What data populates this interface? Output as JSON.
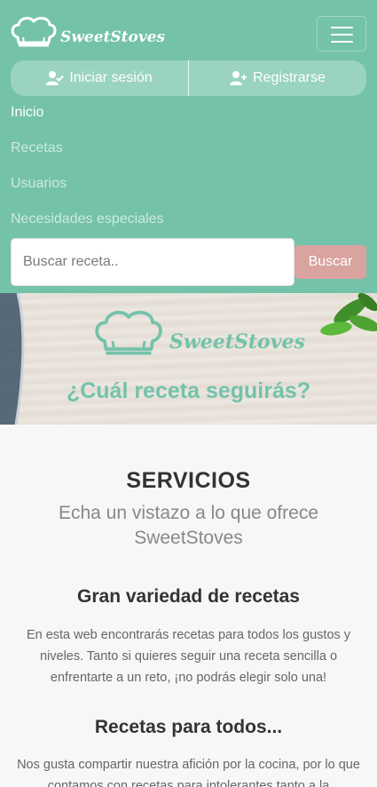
{
  "brand": {
    "name": "SweetStoves"
  },
  "navbar": {
    "login_label": "Iniciar sesión",
    "register_label": "Registrarse",
    "links": [
      {
        "label": "Inicio",
        "active": true
      },
      {
        "label": "Recetas",
        "active": false
      },
      {
        "label": "Usuarios",
        "active": false
      },
      {
        "label": "Necesidades especiales",
        "active": false
      }
    ],
    "search_placeholder": "Buscar receta..",
    "search_button": "Buscar"
  },
  "hero": {
    "brand": "SweetStoves",
    "title": "¿Cuál receta seguirás?"
  },
  "services": {
    "title": "SERVICIOS",
    "subtitle": "Echa un vistazo a lo que ofrece SweetStoves",
    "items": [
      {
        "title": "Gran variedad de recetas",
        "text": "En esta web encontrarás recetas para todos los gustos y niveles. Tanto si quieres seguir una receta sencilla o enfrentarte a un reto, ¡no podrás elegir solo una!"
      },
      {
        "title": "Recetas para todos...",
        "text": "Nos gusta compartir nuestra afición por la cocina, por lo que contamos con recetas para intolerantes tanto a la"
      }
    ]
  },
  "colors": {
    "primary": "#74c2aa",
    "accent": "#d9a3a0"
  }
}
